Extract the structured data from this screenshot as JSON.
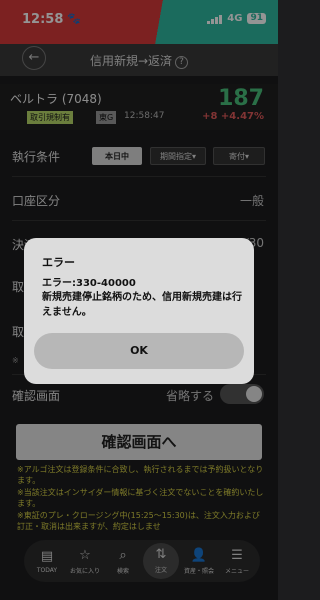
{
  "status_bar": {
    "time": "12:58",
    "network": "4G",
    "battery": "91"
  },
  "header": {
    "back_icon": "arrow-left-icon",
    "title": "信用新規→返済",
    "help": "?"
  },
  "stock": {
    "name": "ベルトラ (7048)",
    "badge_restriction": "取引規制有",
    "badge_market": "東G",
    "time": "12:58:47",
    "price": "187",
    "change": "+8  +4.47%"
  },
  "form": {
    "condition_label": "執行条件",
    "condition_options": [
      "本日中",
      "期間指定▾",
      "寄付▾"
    ],
    "account_label": "口座区分",
    "account_value": "一般",
    "settle_label_partial": "決済",
    "settle_value_partial": "/30",
    "partial_label_1": "取",
    "partial_label_2": "取",
    "partial_note": "※",
    "confirm_screen_label": "確認画面",
    "confirm_screen_skip": "省略する",
    "confirm_button": "確認画面へ"
  },
  "notes": [
    "※アルゴ注文は登録条件に合致し、執行されるまでは予約扱いとなります。",
    "※当該注文はインサイダー情報に基づく注文でないことを確約いたします。",
    "※東証のプレ・クロージング中(15:25～15:30)は、注文入力および訂正・取消は出来ますが、約定はしませ"
  ],
  "nav": [
    {
      "label": "TODAY",
      "icon": "document-icon"
    },
    {
      "label": "お気に入り",
      "icon": "star-icon"
    },
    {
      "label": "検索",
      "icon": "search-icon"
    },
    {
      "label": "注文",
      "icon": "order-icon"
    },
    {
      "label": "資産・照会",
      "icon": "person-icon"
    },
    {
      "label": "メニュー",
      "icon": "menu-icon"
    }
  ],
  "dialog": {
    "title": "エラー",
    "code": "エラー:330-40000",
    "message": "新規売建停止銘柄のため、信用新規売建は行えません。",
    "ok": "OK"
  },
  "colors": {
    "up_red": "#e05a5a",
    "price_green": "#49c07a",
    "note_yellow": "#d6d046"
  }
}
